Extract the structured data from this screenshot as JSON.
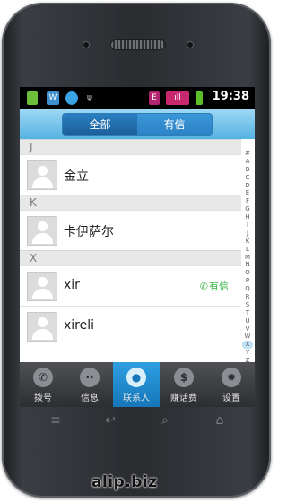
{
  "status_bar": {
    "time": "19:38",
    "left_icons": [
      "app-icon",
      "wechat-icon",
      "qq-icon",
      "usb-icon"
    ],
    "right_icons": [
      "sim-icon",
      "signal-icon",
      "battery-icon"
    ]
  },
  "tabs": {
    "all": "全部",
    "youxin": "有信",
    "active": "all"
  },
  "contacts": {
    "sections": [
      {
        "letter": "J",
        "items": [
          {
            "name": "金立",
            "youxin": false
          }
        ]
      },
      {
        "letter": "K",
        "items": [
          {
            "name": "卡伊萨尔",
            "youxin": false
          }
        ]
      },
      {
        "letter": "X",
        "items": [
          {
            "name": "xir",
            "youxin": true
          },
          {
            "name": "xireli",
            "youxin": false
          }
        ]
      }
    ],
    "youxin_label": "有信"
  },
  "alphabet_index": [
    "#",
    "A",
    "B",
    "C",
    "D",
    "E",
    "F",
    "G",
    "H",
    "I",
    "J",
    "K",
    "L",
    "M",
    "N",
    "O",
    "P",
    "Q",
    "R",
    "S",
    "T",
    "U",
    "V",
    "W",
    "X",
    "Y",
    "Z"
  ],
  "alphabet_highlight": "X",
  "bottom_nav": [
    {
      "id": "dial",
      "label": "拨号",
      "icon": "phone-icon",
      "active": false
    },
    {
      "id": "messages",
      "label": "信息",
      "icon": "chat-bubble-icon",
      "active": false
    },
    {
      "id": "contacts",
      "label": "联系人",
      "icon": "person-icon",
      "active": true
    },
    {
      "id": "earn",
      "label": "赚话费",
      "icon": "money-bag-icon",
      "active": false
    },
    {
      "id": "settings",
      "label": "设置",
      "icon": "gear-icon",
      "active": false
    }
  ],
  "colors": {
    "accent": "#2d82c6",
    "youxin_green": "#3cb54a",
    "nav_active": "#1676b9"
  },
  "watermark": "alip.biz"
}
